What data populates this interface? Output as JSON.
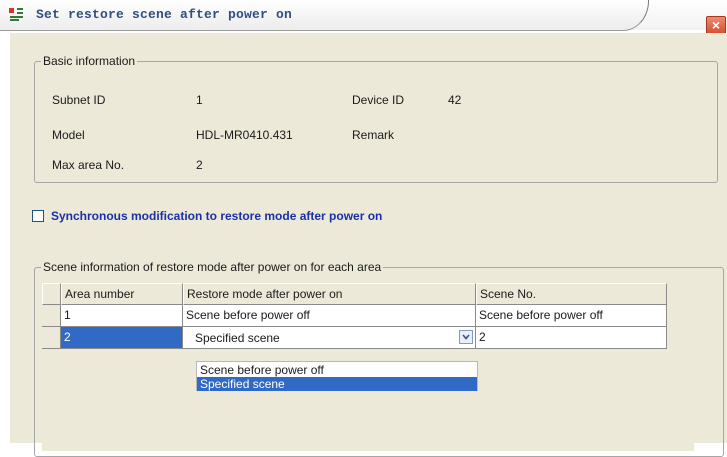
{
  "window": {
    "title": "Set restore scene after power on",
    "close_glyph": "×"
  },
  "basic_info": {
    "legend": "Basic information",
    "subnet_id_label": "Subnet ID",
    "subnet_id_value": "1",
    "device_id_label": "Device ID",
    "device_id_value": "42",
    "model_label": "Model",
    "model_value": "HDL-MR0410.431",
    "remark_label": "Remark",
    "max_area_label": "Max area No.",
    "max_area_value": "2"
  },
  "sync_option": {
    "label": "Synchronous modification to restore mode after power on",
    "checked": false
  },
  "scene_group": {
    "legend": "Scene information of restore mode after power on for each area",
    "columns": [
      "Area number",
      "Restore mode after power on",
      "Scene No."
    ],
    "rows": [
      {
        "area": "1",
        "mode": "Scene before power off",
        "scene": "Scene before power off"
      },
      {
        "area": "2",
        "mode": "Specified scene",
        "scene": "2"
      }
    ],
    "dropdown_options": [
      "Scene before power off",
      "Specified scene"
    ],
    "dropdown_selected": "Specified scene"
  },
  "colors": {
    "selection": "#316ac5",
    "dialog_bg": "#ece9d8",
    "sync_label": "#1b2fa8"
  }
}
